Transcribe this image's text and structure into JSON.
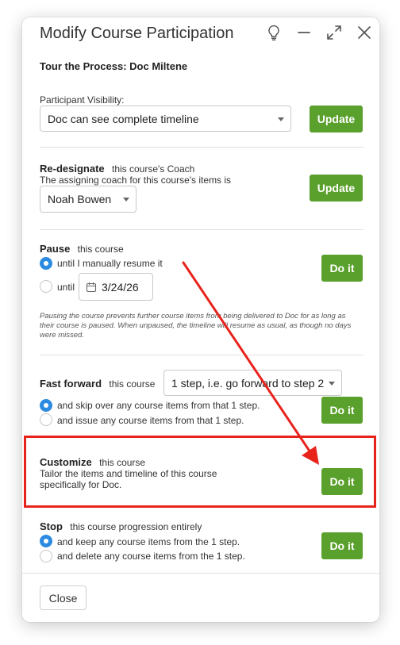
{
  "dialog": {
    "title": "Modify Course Participation",
    "subtitle": "Tour the Process: Doc Miltene",
    "close_label": "Close"
  },
  "visibility": {
    "label": "Participant Visibility:",
    "selected": "Doc can see complete timeline",
    "button": "Update"
  },
  "redesignate": {
    "heading": "Re-designate",
    "heading_suffix": "this course's Coach",
    "description": "The assigning coach for this course's items is",
    "selected": "Noah Bowen",
    "button": "Update"
  },
  "pause": {
    "heading": "Pause",
    "heading_suffix": "this course",
    "option_manual": "until I manually resume it",
    "option_until": "until",
    "date": "3/24/26",
    "button": "Do it",
    "note": "Pausing the course prevents further course items from being delivered to Doc for as long as their course is paused. When unpaused, the timeline will resume as usual, as though no days were missed."
  },
  "fast_forward": {
    "heading": "Fast forward",
    "heading_suffix": "this course",
    "selected": "1 step, i.e. go forward to step 2",
    "option_skip": "and skip over any course items from that 1 step.",
    "option_issue": "and issue any course items from that 1 step.",
    "button": "Do it"
  },
  "customize": {
    "heading": "Customize",
    "heading_suffix": "this course",
    "description_line1": "Tailor the items and timeline of this course",
    "description_line2": "specifically for Doc.",
    "button": "Do it"
  },
  "stop": {
    "heading": "Stop",
    "heading_suffix": "this course progression entirely",
    "option_keep": "and keep any course items from the 1 step.",
    "option_delete": "and delete any course items from the 1 step.",
    "button": "Do it"
  },
  "colors": {
    "button_green": "#5aa02c",
    "radio_blue": "#2c8be0",
    "annotation_red": "#e8231c"
  }
}
